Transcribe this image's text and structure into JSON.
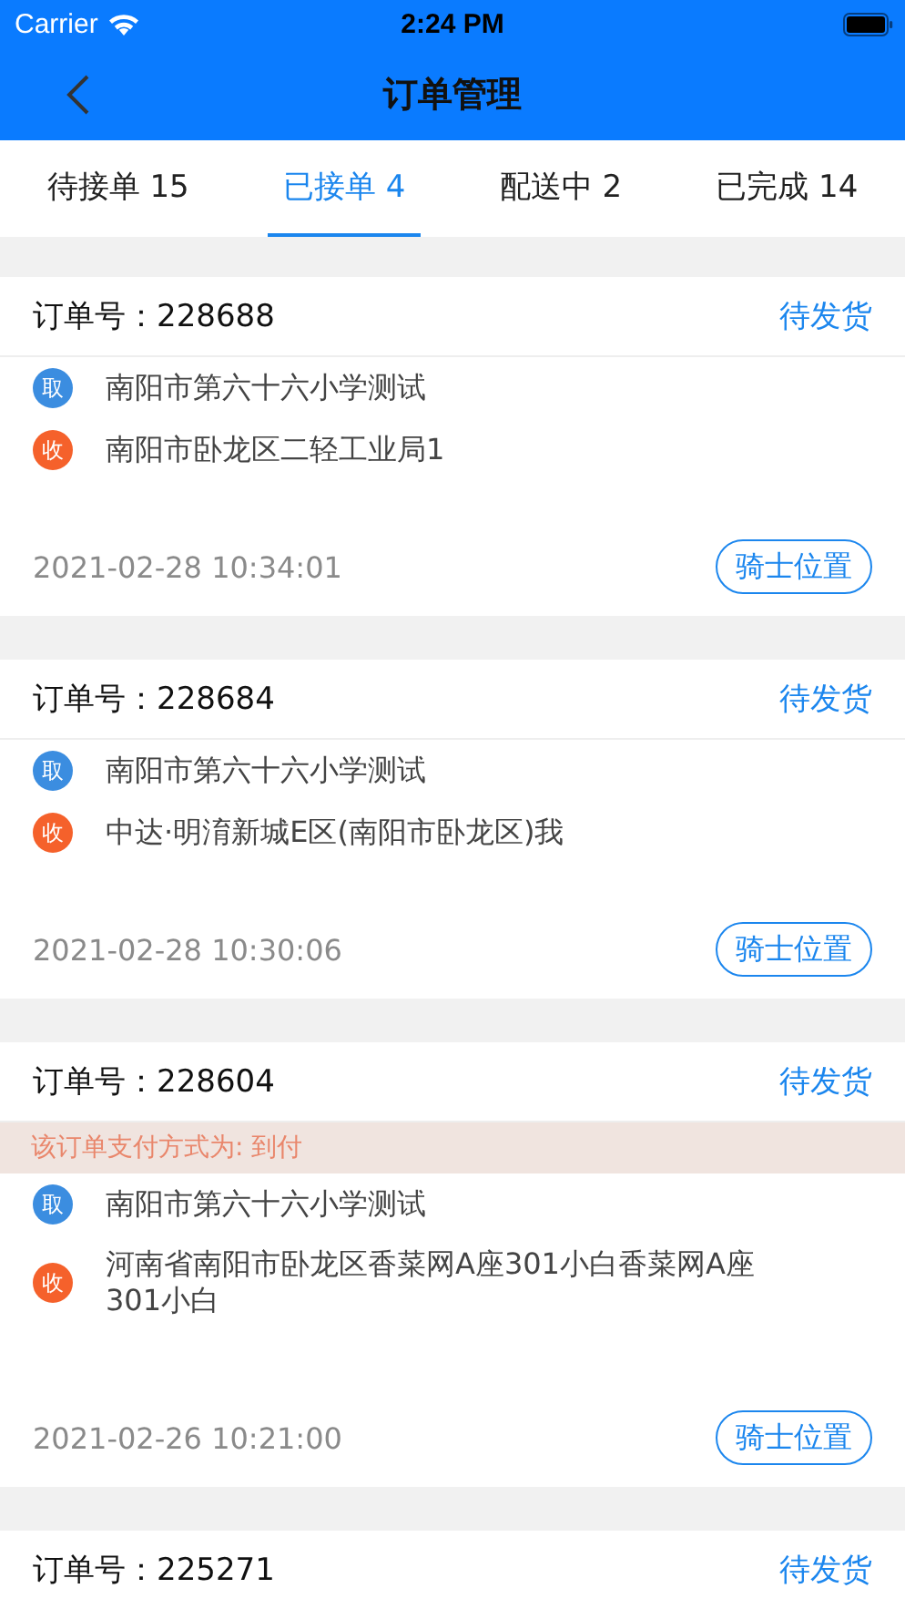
{
  "status_bar": {
    "carrier": "Carrier",
    "time": "2:24 PM"
  },
  "nav": {
    "title": "订单管理"
  },
  "tabs": [
    {
      "label": "待接单 15",
      "selected": false
    },
    {
      "label": "已接单 4",
      "selected": true
    },
    {
      "label": "配送中 2",
      "selected": false
    },
    {
      "label": "已完成 14",
      "selected": false
    }
  ],
  "orders": [
    {
      "order_no": "订单号：228688",
      "status": "待发货",
      "stops": [
        {
          "kind": "pickup",
          "badge": "取",
          "address": "南阳市第六十六小学测试"
        },
        {
          "kind": "delivery",
          "badge": "收",
          "address": "南阳市卧龙区二轻工业局1"
        }
      ],
      "time": "2021-02-28 10:34:01",
      "button": "骑士位置"
    },
    {
      "order_no": "订单号：228684",
      "status": "待发货",
      "stops": [
        {
          "kind": "pickup",
          "badge": "取",
          "address": "南阳市第六十六小学测试"
        },
        {
          "kind": "delivery",
          "badge": "收",
          "address": "中达·明淯新城E区(南阳市卧龙区)我"
        }
      ],
      "time": "2021-02-28 10:30:06",
      "button": "骑士位置"
    },
    {
      "order_no": "订单号：228604",
      "status": "待发货",
      "notice": "该订单支付方式为: 到付",
      "stops": [
        {
          "kind": "pickup",
          "badge": "取",
          "address": "南阳市第六十六小学测试"
        },
        {
          "kind": "delivery",
          "badge": "收",
          "address": "河南省南阳市卧龙区香菜网A座301小白香菜网A座301小白"
        }
      ],
      "time": "2021-02-26 10:21:00",
      "button": "骑士位置"
    },
    {
      "order_no": "订单号：225271",
      "status": "待发货"
    }
  ]
}
